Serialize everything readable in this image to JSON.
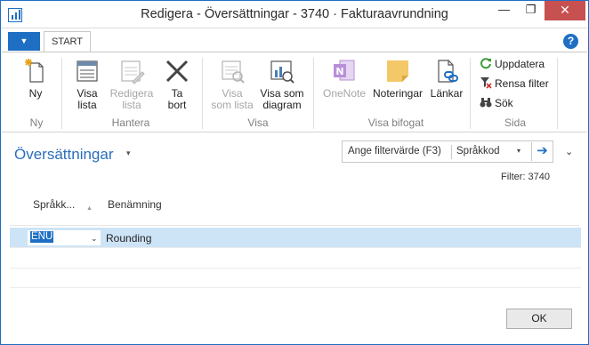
{
  "window": {
    "title": "Redigera - Översättningar - 3740 · Fakturaavrundning",
    "minimize_glyph": "—",
    "maximize_glyph": "❐",
    "close_glyph": "✕"
  },
  "ribbon_tabs": {
    "menu_glyph": "▼",
    "active": "START",
    "help_glyph": "?"
  },
  "ribbon": {
    "groups": {
      "ny": "Ny",
      "hantera": "Hantera",
      "visa": "Visa",
      "visa_bifogat": "Visa bifogat",
      "sida": "Sida"
    },
    "buttons": {
      "ny": "Ny",
      "visa_lista": [
        "Visa",
        "lista"
      ],
      "redigera_lista": [
        "Redigera",
        "lista"
      ],
      "ta_bort": [
        "Ta",
        "bort"
      ],
      "visa_som_lista": [
        "Visa",
        "som lista"
      ],
      "visa_som_diagram": [
        "Visa som",
        "diagram"
      ],
      "onenote": "OneNote",
      "noteringar": "Noteringar",
      "lankar": "Länkar",
      "uppdatera": "Uppdatera",
      "rensa_filter": "Rensa filter",
      "sok": "Sök"
    },
    "colors": {
      "accent": "#1e6fc3",
      "disabled_text": "#a6a6a6",
      "onenote": "#b98fd8",
      "notes": "#f3c868",
      "delete": "#444444",
      "refresh": "#3c9a3c",
      "clear_filter": "#d03030"
    }
  },
  "page": {
    "title": "Översättningar",
    "title_chevron": "▾",
    "filter": {
      "placeholder": "Ange filtervärde (F3)",
      "field": "Språkkod",
      "field_chevron": "▾",
      "go_glyph": "➔",
      "applied": "Filter: 3740"
    },
    "expand_glyph": "⌄",
    "columns": [
      "Språkk...",
      "Benämning"
    ],
    "sort_glyph": "▲",
    "rows": [
      {
        "language_code": "ENU",
        "dropdown_glyph": "⌄",
        "description": "Rounding"
      }
    ],
    "ok_label": "OK"
  }
}
